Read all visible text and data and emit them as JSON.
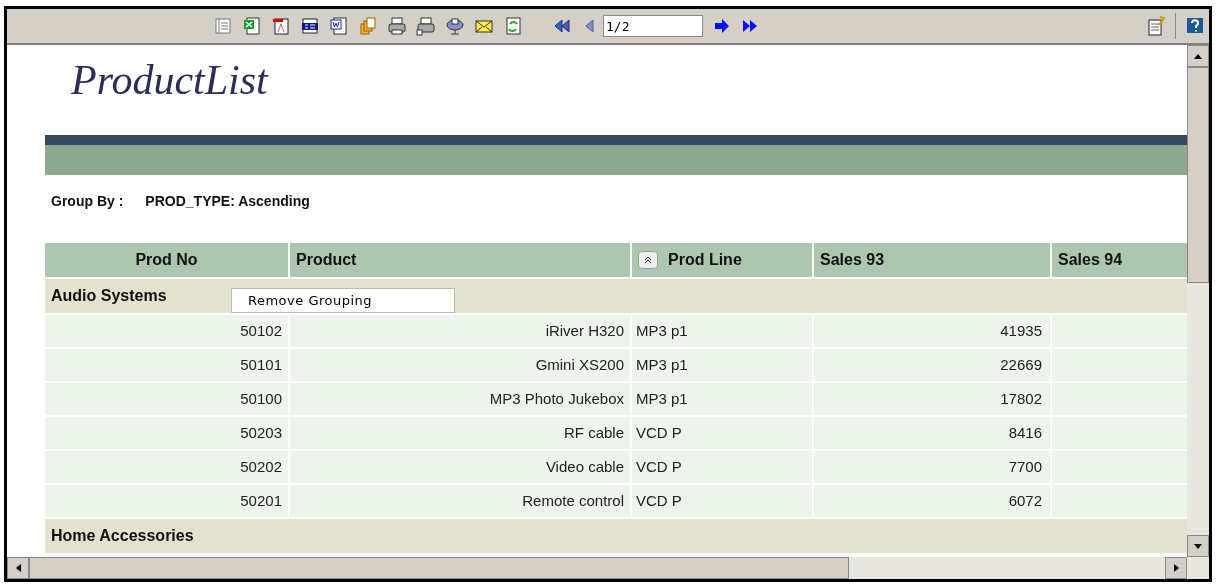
{
  "toolbar": {
    "page_field": {
      "value": "1/2"
    }
  },
  "report": {
    "title": "ProductList",
    "group_by": {
      "label": "Group By :",
      "value": "PROD_TYPE: Ascending"
    }
  },
  "table": {
    "columns": [
      {
        "label": "Prod No",
        "sort_button": false
      },
      {
        "label": "Product",
        "sort_button": false
      },
      {
        "label": "Prod Line",
        "sort_button": true
      },
      {
        "label": "Sales 93",
        "sort_button": false
      },
      {
        "label": "Sales 94",
        "sort_button": false
      }
    ],
    "groups": [
      {
        "name": "Audio Systems",
        "menu": "Remove Grouping",
        "rows": [
          {
            "prod_no": "50102",
            "product": "iRiver H320",
            "prod_line": "MP3 p1",
            "sales_93": "41935"
          },
          {
            "prod_no": "50101",
            "product": "Gmini XS200",
            "prod_line": "MP3 p1",
            "sales_93": "22669"
          },
          {
            "prod_no": "50100",
            "product": "MP3 Photo Jukebox",
            "prod_line": "MP3 p1",
            "sales_93": "17802"
          },
          {
            "prod_no": "50203",
            "product": "RF cable",
            "prod_line": "VCD P",
            "sales_93": "8416"
          },
          {
            "prod_no": "50202",
            "product": "Video cable",
            "prod_line": "VCD P",
            "sales_93": "7700"
          },
          {
            "prod_no": "50201",
            "product": "Remote control",
            "prod_line": "VCD P",
            "sales_93": "6072"
          }
        ]
      },
      {
        "name": "Home Accessories"
      }
    ]
  }
}
